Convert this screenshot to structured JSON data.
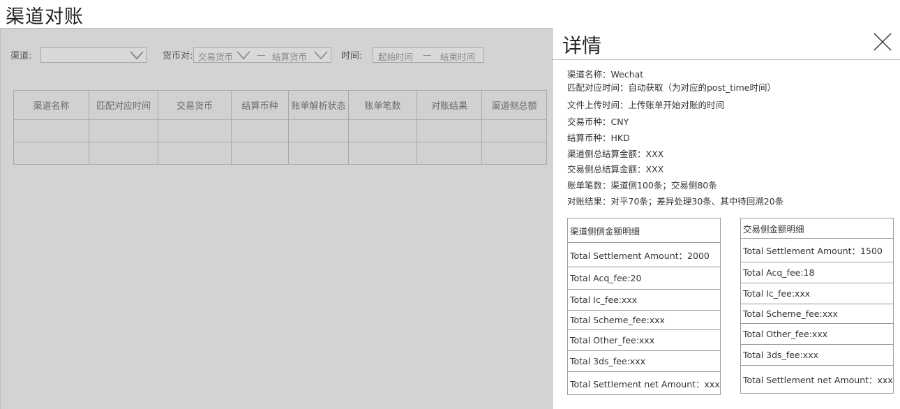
{
  "page": {
    "title": "渠道对账"
  },
  "filters": {
    "channel_label": "渠道:",
    "currency_pair_label": "货币对:",
    "trade_currency_placeholder": "交易货币",
    "dash1": "—",
    "settle_currency_placeholder": "结算货币",
    "time_label": "时间:",
    "start_time_placeholder": "起始时间",
    "dash2": "—",
    "end_time_placeholder": "结束时间"
  },
  "table": {
    "headers": [
      "渠道名称",
      "匹配对应时间",
      "交易货币",
      "结算币种",
      "账单解析状态",
      "账单笔数",
      "对账结果",
      "渠道侧总额"
    ]
  },
  "detail": {
    "title": "详情",
    "lines": [
      "渠道名称：Wechat",
      "匹配对应时间：自动获取（为对应的post_time时间）",
      "文件上传时间：上传账单开始对账的时间",
      "交易币种：CNY",
      "结算币种：HKD",
      "渠道侧总结算金额：XXX",
      "交易侧总结算金额：XXX",
      "账单笔数：渠道侧100条；交易侧80条",
      "对账结果：对平70条；差异处理30条、其中待回溯20条"
    ],
    "channel_table": {
      "rows": [
        "渠道侧侧金额明细",
        "Total Settlement Amount：2000",
        "Total  Acq_fee:20",
        "Total Ic_fee:xxx",
        "Total Scheme_fee:xxx",
        "Total Other_fee:xxx",
        "Total 3ds_fee:xxx",
        "Total Settlement net Amount：xxx"
      ]
    },
    "trade_table": {
      "rows": [
        "交易侧金额明细",
        "Total Settlement Amount：1500",
        "Total  Acq_fee:18",
        "Total Ic_fee:xxx",
        "Total Scheme_fee:xxx",
        "Total Other_fee:xxx",
        "Total 3ds_fee:xxx",
        "Total Settlement net Amount：xxx"
      ]
    }
  }
}
